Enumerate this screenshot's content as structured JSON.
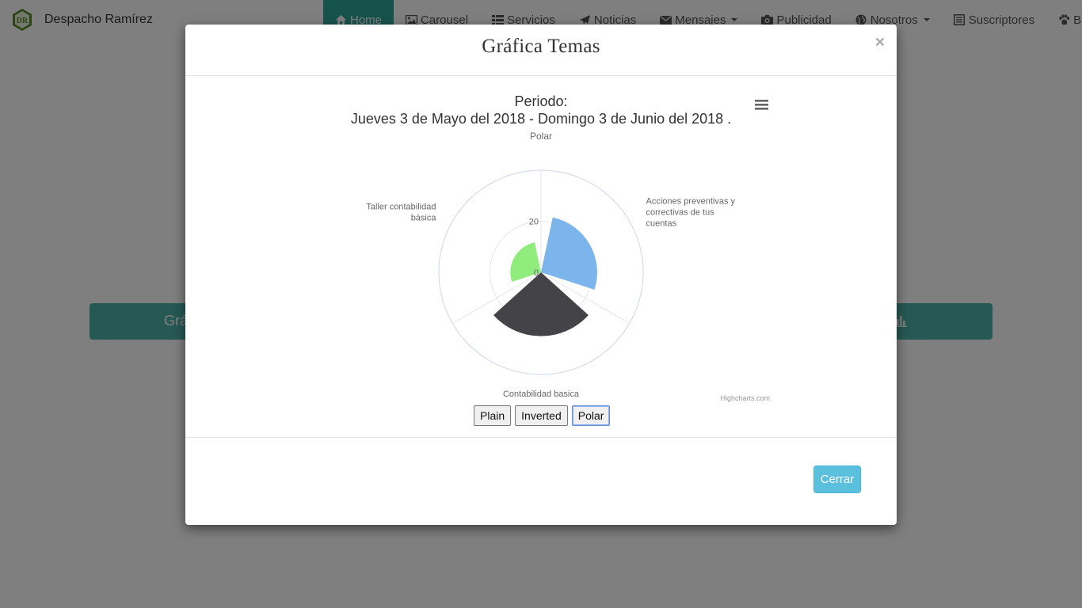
{
  "navbar": {
    "brand": "Despacho Ramírez",
    "items": [
      {
        "label": "Home",
        "icon": "home-icon",
        "active": true,
        "dropdown": false
      },
      {
        "label": "Carousel",
        "icon": "image-icon",
        "active": false,
        "dropdown": false
      },
      {
        "label": "Servicios",
        "icon": "list-icon",
        "active": false,
        "dropdown": false
      },
      {
        "label": "Noticias",
        "icon": "paper-plane-icon",
        "active": false,
        "dropdown": false
      },
      {
        "label": "Mensajes",
        "icon": "envelope-icon",
        "active": false,
        "dropdown": true
      },
      {
        "label": "Publicidad",
        "icon": "camera-icon",
        "active": false,
        "dropdown": false
      },
      {
        "label": "Nosotros",
        "icon": "globe-icon",
        "active": false,
        "dropdown": true
      },
      {
        "label": "Suscriptores",
        "icon": "list-alt-icon",
        "active": false,
        "dropdown": false
      },
      {
        "label": "Bienvenida",
        "icon": "paw-icon",
        "active": false,
        "dropdown": false
      }
    ]
  },
  "background": {
    "bar_text": "Grá"
  },
  "modal": {
    "title": "Gráfica Temas",
    "close": "×",
    "footer": {
      "close_button": "Cerrar"
    }
  },
  "chart_buttons": [
    {
      "label": "Plain",
      "selected": false
    },
    {
      "label": "Inverted",
      "selected": false
    },
    {
      "label": "Polar",
      "selected": true
    }
  ],
  "chart_data": {
    "type": "bar",
    "polar": true,
    "title": "Periodo:",
    "title_line2": "Jueves 3 de Mayo del 2018 - Domingo 3 de Junio del 2018 .",
    "subtitle": "Polar",
    "credits": "Highcharts.com",
    "categories": [
      "Acciones preventivas y correctivas de tus cuentas",
      "Contabilidad basica",
      "Taller contabilidad básica"
    ],
    "values": [
      22,
      25,
      12
    ],
    "colors": [
      "#7cb5ec",
      "#434348",
      "#90ed7d"
    ],
    "y_ticks": [
      0,
      20
    ],
    "ylim": [
      0,
      40
    ],
    "grid": true,
    "legend": false
  }
}
